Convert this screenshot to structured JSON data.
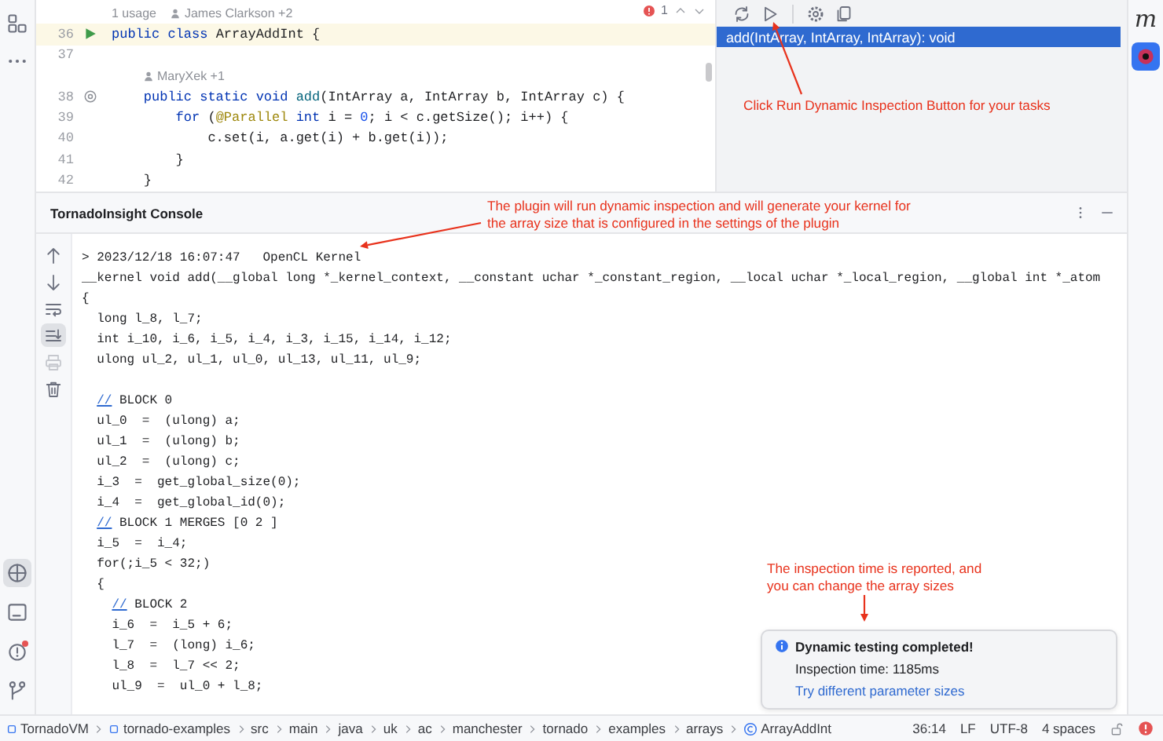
{
  "left_stripe": {
    "top_tools": [
      {
        "kind": "structure",
        "selected": false
      },
      {
        "kind": "more",
        "selected": false
      }
    ],
    "bottom_tools": [
      {
        "kind": "plugin",
        "selected": true,
        "alert": false
      },
      {
        "kind": "terminal",
        "selected": false,
        "alert": false
      },
      {
        "kind": "problems",
        "selected": false,
        "alert": true
      },
      {
        "kind": "git",
        "selected": false,
        "alert": false
      }
    ]
  },
  "editor": {
    "problems_count": "1",
    "lines": [
      {
        "kind": "hint",
        "usages": "1 usage",
        "authors": "James Clarkson +2"
      },
      {
        "kind": "code",
        "number": "36",
        "gutter": {
          "kind": "run"
        },
        "current": true,
        "tokens": [
          {
            "text": "public class ",
            "kind": "keyword"
          },
          {
            "text": "ArrayAddInt {",
            "kind": "plain"
          }
        ]
      },
      {
        "kind": "code",
        "number": "37",
        "current": false
      },
      {
        "kind": "hint",
        "authors": "MaryXek +1"
      },
      {
        "kind": "code",
        "number": "38",
        "gutter": {
          "kind": "override"
        },
        "current": false,
        "tokens": [
          {
            "text": "    public static void ",
            "kind": "keyword"
          },
          {
            "text": "add",
            "kind": "method"
          },
          {
            "text": "(IntArray a, IntArray b, IntArray c) {",
            "kind": "plain"
          }
        ]
      },
      {
        "kind": "code",
        "number": "39",
        "current": false,
        "tokens": [
          {
            "text": "        for",
            "kind": "keyword"
          },
          {
            "text": " (",
            "kind": "plain"
          },
          {
            "text": "@Parallel",
            "kind": "annotation"
          },
          {
            "text": " int",
            "kind": "keyword"
          },
          {
            "text": " i = ",
            "kind": "plain"
          },
          {
            "text": "0",
            "kind": "number"
          },
          {
            "text": "; i < c.getSize(); i++) {",
            "kind": "plain"
          }
        ]
      },
      {
        "kind": "code",
        "number": "40",
        "current": false,
        "tokens": [
          {
            "text": "            c.set(i, a.get(i) + b.get(i));",
            "kind": "plain"
          }
        ]
      },
      {
        "kind": "code",
        "number": "41",
        "current": false,
        "tokens": [
          {
            "text": "        }",
            "kind": "plain"
          }
        ]
      },
      {
        "kind": "code",
        "number": "42",
        "current": false,
        "tokens": [
          {
            "text": "    }",
            "kind": "plain"
          }
        ]
      }
    ]
  },
  "panel": {
    "tools": [
      {
        "kind": "refresh"
      },
      {
        "kind": "run"
      },
      {
        "kind": "settings"
      },
      {
        "kind": "copy"
      }
    ],
    "methods": [
      {
        "text": "add(IntArray, IntArray, IntArray): void",
        "selected": true
      }
    ]
  },
  "right_stripe": {
    "tools": [
      {
        "kind": "maven",
        "glyph": "m",
        "selected": false
      },
      {
        "kind": "inspector",
        "selected": true
      }
    ]
  },
  "console": {
    "title": "TornadoInsight Console",
    "tools": [
      {
        "kind": "up",
        "selected": false,
        "disabled": false
      },
      {
        "kind": "down",
        "selected": false,
        "disabled": false
      },
      {
        "kind": "wrap",
        "selected": false,
        "disabled": false
      },
      {
        "kind": "scroll-end",
        "selected": true,
        "disabled": false
      },
      {
        "kind": "print",
        "selected": false,
        "disabled": true
      },
      {
        "kind": "clear",
        "selected": false,
        "disabled": false
      }
    ],
    "lines": [
      {
        "kind": "plain",
        "text": "> 2023/12/18 16:07:47   OpenCL Kernel"
      },
      {
        "kind": "plain",
        "text": "__kernel void add(__global long *_kernel_context, __constant uchar *_constant_region, __local uchar *_local_region, __global int *_atom"
      },
      {
        "kind": "plain",
        "text": "{"
      },
      {
        "kind": "plain",
        "text": "  long l_8, l_7;"
      },
      {
        "kind": "plain",
        "text": "  int i_10, i_6, i_5, i_4, i_3, i_15, i_14, i_12;"
      },
      {
        "kind": "plain",
        "text": "  ulong ul_2, ul_1, ul_0, ul_13, ul_11, ul_9;"
      },
      {
        "kind": "blank"
      },
      {
        "kind": "comment",
        "nested": false,
        "marker": "//",
        "text": "BLOCK 0"
      },
      {
        "kind": "plain",
        "text": "  ul_0  =  (ulong) a;"
      },
      {
        "kind": "plain",
        "text": "  ul_1  =  (ulong) b;"
      },
      {
        "kind": "plain",
        "text": "  ul_2  =  (ulong) c;"
      },
      {
        "kind": "plain",
        "text": "  i_3  =  get_global_size(0);"
      },
      {
        "kind": "plain",
        "text": "  i_4  =  get_global_id(0);"
      },
      {
        "kind": "comment",
        "nested": false,
        "marker": "//",
        "text": "BLOCK 1 MERGES [0 2 ]"
      },
      {
        "kind": "plain",
        "text": "  i_5  =  i_4;"
      },
      {
        "kind": "plain",
        "text": "  for(;i_5 < 32;)"
      },
      {
        "kind": "plain",
        "text": "  {"
      },
      {
        "kind": "comment",
        "nested": true,
        "marker": "//",
        "text": "BLOCK 2"
      },
      {
        "kind": "plain",
        "text": "    i_6  =  i_5 + 6;"
      },
      {
        "kind": "plain",
        "text": "    l_7  =  (long) i_6;"
      },
      {
        "kind": "plain",
        "text": "    l_8  =  l_7 << 2;"
      },
      {
        "kind": "plain",
        "text": "    ul_9  =  ul_0 + l_8;"
      }
    ]
  },
  "notification": {
    "title": "Dynamic testing completed!",
    "body": "Inspection time: 1185ms",
    "link": "Try different parameter sizes"
  },
  "annotations": [
    {
      "text": "Click Run Dynamic Inspection Button for your tasks"
    },
    {
      "text": "The plugin will run dynamic inspection and will generate your kernel for\nthe array size that is configured in the settings of the plugin"
    },
    {
      "text": "The inspection time is reported, and\nyou can change the array sizes"
    }
  ],
  "status_bar": {
    "breadcrumbs": [
      {
        "text": "TornadoVM",
        "kind": "module"
      },
      {
        "text": "tornado-examples",
        "kind": "module"
      },
      {
        "text": "src",
        "kind": "folder"
      },
      {
        "text": "main",
        "kind": "folder"
      },
      {
        "text": "java",
        "kind": "folder"
      },
      {
        "text": "uk",
        "kind": "folder"
      },
      {
        "text": "ac",
        "kind": "folder"
      },
      {
        "text": "manchester",
        "kind": "folder"
      },
      {
        "text": "tornado",
        "kind": "folder"
      },
      {
        "text": "examples",
        "kind": "folder"
      },
      {
        "text": "arrays",
        "kind": "folder"
      },
      {
        "text": "ArrayAddInt",
        "kind": "class"
      }
    ],
    "position": "36:14",
    "line_ending": "LF",
    "encoding": "UTF-8",
    "indent": "4 spaces"
  }
}
